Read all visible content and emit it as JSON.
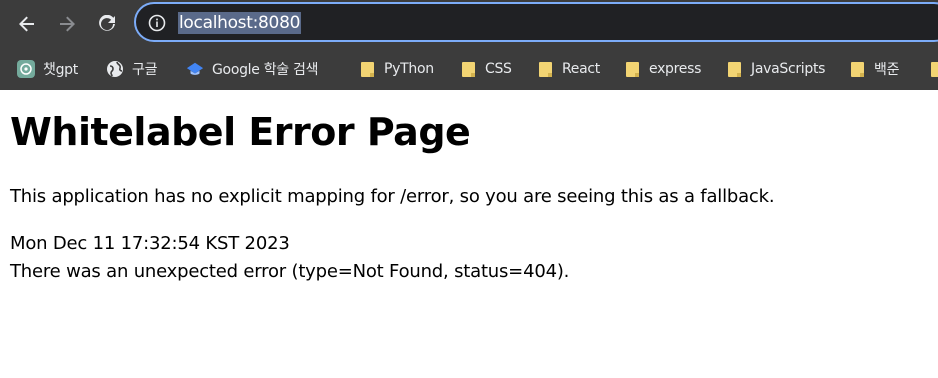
{
  "browser": {
    "url": "localhost:8080",
    "bookmarks": [
      {
        "label": "챗gpt",
        "icon": "chatgpt-icon"
      },
      {
        "label": "구글",
        "icon": "globe-icon"
      },
      {
        "label": "Google 학술 검색",
        "icon": "graduation-cap-icon"
      },
      {
        "label": "PyThon",
        "icon": "folder-icon"
      },
      {
        "label": "CSS",
        "icon": "folder-icon"
      },
      {
        "label": "React",
        "icon": "folder-icon"
      },
      {
        "label": "express",
        "icon": "folder-icon"
      },
      {
        "label": "JavaScripts",
        "icon": "folder-icon"
      },
      {
        "label": "백준",
        "icon": "folder-icon"
      }
    ]
  },
  "page": {
    "title": "Whitelabel Error Page",
    "explanation": "This application has no explicit mapping for /error, so you are seeing this as a fallback.",
    "timestamp": "Mon Dec 11 17:32:54 KST 2023",
    "error_detail": "There was an unexpected error (type=Not Found, status=404)."
  },
  "colors": {
    "chrome_background": "#3c3c3c",
    "omnibox_border": "#7cacf8",
    "url_selection": "#5a6a8a",
    "folder": "#f2d473"
  }
}
